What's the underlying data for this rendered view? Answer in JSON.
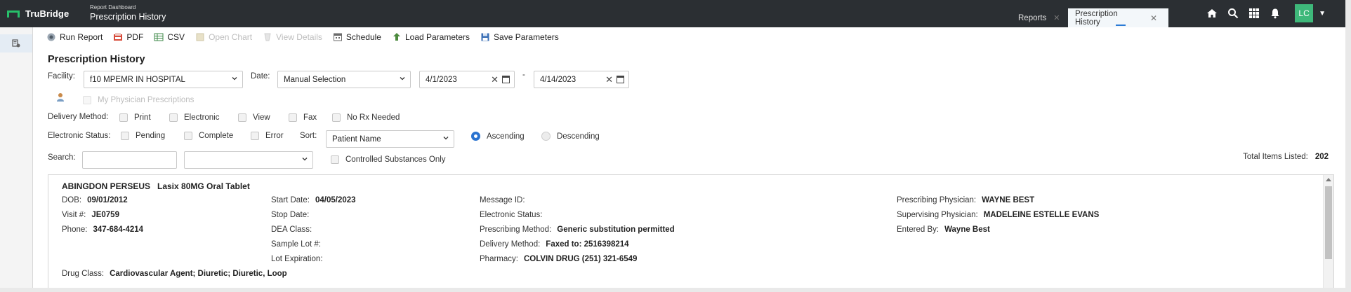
{
  "header": {
    "brand": "TruBridge",
    "breadcrumb_parent": "Report Dashboard",
    "breadcrumb_current": "Prescription History",
    "tabs": [
      {
        "label": "Reports",
        "active": false
      },
      {
        "label": "Prescription History",
        "active": true
      }
    ],
    "user_initials": "LC",
    "icons": [
      "home-icon",
      "search-icon",
      "apps-grid-icon",
      "bell-icon"
    ]
  },
  "toolbar": {
    "run_report": "Run Report",
    "pdf": "PDF",
    "csv": "CSV",
    "open_chart": "Open Chart",
    "view_details": "View Details",
    "schedule": "Schedule",
    "load_parameters": "Load Parameters",
    "save_parameters": "Save Parameters"
  },
  "page": {
    "title": "Prescription History",
    "facility_label": "Facility:",
    "facility_value": "f10 MPEMR IN HOSPITAL",
    "date_label": "Date:",
    "date_mode": "Manual Selection",
    "date_from": "4/1/2023",
    "date_sep": "-",
    "date_to": "4/14/2023",
    "my_physician": "My Physician Prescriptions",
    "delivery_label": "Delivery Method:",
    "delivery_options": [
      "Print",
      "Electronic",
      "View",
      "Fax",
      "No Rx Needed"
    ],
    "status_label": "Electronic Status:",
    "status_options": [
      "Pending",
      "Complete",
      "Error"
    ],
    "sort_label": "Sort:",
    "sort_value": "Patient Name",
    "ascending": "Ascending",
    "descending": "Descending",
    "search_label": "Search:",
    "search_value": "",
    "search_scope": "",
    "controlled_only": "Controlled Substances Only",
    "total_label": "Total Items Listed:",
    "total_value": "202"
  },
  "record": {
    "patient": "ABINGDON PERSEUS",
    "medication": "Lasix 80MG Oral Tablet",
    "dob_label": "DOB:",
    "dob": "09/01/2012",
    "visit_label": "Visit #:",
    "visit": "JE0759",
    "phone_label": "Phone:",
    "phone": "347-684-4214",
    "start_label": "Start Date:",
    "start": "04/05/2023",
    "stop_label": "Stop Date:",
    "stop": "",
    "dea_label": "DEA Class:",
    "dea": "",
    "lot_label": "Sample Lot #:",
    "lot": "",
    "lotexp_label": "Lot Expiration:",
    "lotexp": "",
    "msg_label": "Message ID:",
    "msg": "",
    "estatus_label": "Electronic Status:",
    "estatus": "",
    "pmethod_label": "Prescribing Method:",
    "pmethod": "Generic substitution permitted",
    "dmethod_label": "Delivery Method:",
    "dmethod": "Faxed to: 2516398214",
    "pharmacy_label": "Pharmacy:",
    "pharmacy": "COLVIN DRUG (251) 321-6549",
    "pphys_label": "Prescribing Physician:",
    "pphys": "WAYNE BEST",
    "sphys_label": "Supervising Physician:",
    "sphys": "MADELEINE ESTELLE EVANS",
    "entered_label": "Entered By:",
    "entered": "Wayne Best",
    "drugclass_label": "Drug Class:",
    "drugclass": "Cardiovascular Agent; Diuretic; Diuretic, Loop"
  }
}
